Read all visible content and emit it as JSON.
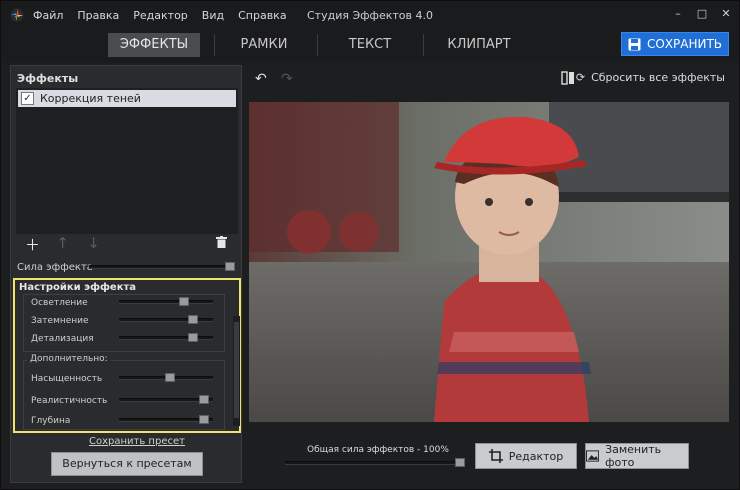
{
  "app": {
    "title": "Студия Эффектов 4.0",
    "menu": [
      "Файл",
      "Правка",
      "Редактор",
      "Вид",
      "Справка"
    ]
  },
  "tabs": [
    "ЭФФЕКТЫ",
    "РАМКИ",
    "ТЕКСТ",
    "КЛИПАРТ"
  ],
  "save_button": "СОХРАНИТЬ",
  "effects_panel": {
    "title": "Эффекты",
    "items": [
      "Коррекция теней"
    ],
    "strength_label": "Сила эффекта",
    "strength_value": 1.0
  },
  "settings_panel": {
    "title": "Настройки эффекта",
    "group1": [
      {
        "label": "Осветление",
        "value": 0.72
      },
      {
        "label": "Затемнение",
        "value": 0.82
      },
      {
        "label": "Детализация",
        "value": 0.82
      }
    ],
    "group2_title": "Дополнительно:",
    "group2": [
      {
        "label": "Насыщенность",
        "value": 0.55
      },
      {
        "label": "Реалистичность",
        "value": 0.95
      },
      {
        "label": "Глубина",
        "value": 0.95
      }
    ]
  },
  "save_preset": "Сохранить пресет",
  "back_button": "Вернуться к пресетам",
  "toolbar": {
    "reset": "Сбросить все эффекты"
  },
  "bottom": {
    "overall_label": "Общая сила эффектов - 100%",
    "overall_value": 1.0,
    "editor_button": "Редактор",
    "replace_button": "Заменить фото"
  },
  "colors": {
    "accent": "#1f6fd6",
    "highlight": "#f2e36a"
  }
}
